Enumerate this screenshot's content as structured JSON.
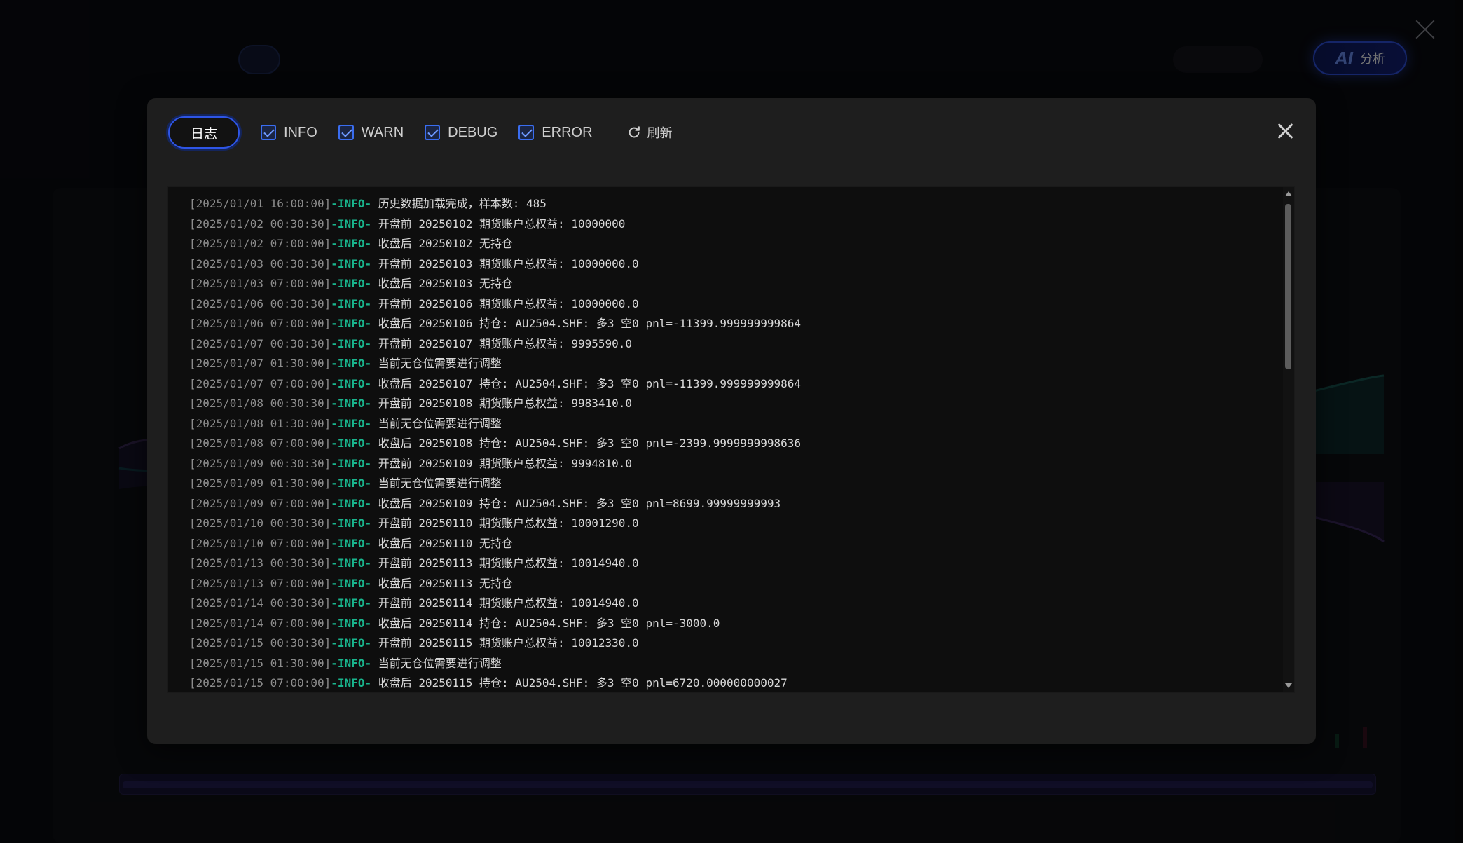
{
  "modal": {
    "tab_label": "日志",
    "filters": [
      {
        "label": "INFO",
        "checked": true
      },
      {
        "label": "WARN",
        "checked": true
      },
      {
        "label": "DEBUG",
        "checked": true
      },
      {
        "label": "ERROR",
        "checked": true
      }
    ],
    "refresh_label": "刷新"
  },
  "header": {
    "ai_glyph": "AI",
    "ai_label": "分析"
  },
  "logs": [
    {
      "ts": "[2025/01/01 16:00:00]",
      "level": "-INFO-",
      "msg": " 历史数据加载完成，样本数: 485"
    },
    {
      "ts": "[2025/01/02 00:30:30]",
      "level": "-INFO-",
      "msg": " 开盘前 20250102 期货账户总权益: 10000000"
    },
    {
      "ts": "[2025/01/02 07:00:00]",
      "level": "-INFO-",
      "msg": " 收盘后 20250102 无持仓"
    },
    {
      "ts": "[2025/01/03 00:30:30]",
      "level": "-INFO-",
      "msg": " 开盘前 20250103 期货账户总权益: 10000000.0"
    },
    {
      "ts": "[2025/01/03 07:00:00]",
      "level": "-INFO-",
      "msg": " 收盘后 20250103 无持仓"
    },
    {
      "ts": "[2025/01/06 00:30:30]",
      "level": "-INFO-",
      "msg": " 开盘前 20250106 期货账户总权益: 10000000.0"
    },
    {
      "ts": "[2025/01/06 07:00:00]",
      "level": "-INFO-",
      "msg": " 收盘后 20250106 持仓: AU2504.SHF: 多3 空0 pnl=-11399.999999999864"
    },
    {
      "ts": "[2025/01/07 00:30:30]",
      "level": "-INFO-",
      "msg": " 开盘前 20250107 期货账户总权益: 9995590.0"
    },
    {
      "ts": "[2025/01/07 01:30:00]",
      "level": "-INFO-",
      "msg": " 当前无仓位需要进行调整"
    },
    {
      "ts": "[2025/01/07 07:00:00]",
      "level": "-INFO-",
      "msg": " 收盘后 20250107 持仓: AU2504.SHF: 多3 空0 pnl=-11399.999999999864"
    },
    {
      "ts": "[2025/01/08 00:30:30]",
      "level": "-INFO-",
      "msg": " 开盘前 20250108 期货账户总权益: 9983410.0"
    },
    {
      "ts": "[2025/01/08 01:30:00]",
      "level": "-INFO-",
      "msg": " 当前无仓位需要进行调整"
    },
    {
      "ts": "[2025/01/08 07:00:00]",
      "level": "-INFO-",
      "msg": " 收盘后 20250108 持仓: AU2504.SHF: 多3 空0 pnl=-2399.9999999998636"
    },
    {
      "ts": "[2025/01/09 00:30:30]",
      "level": "-INFO-",
      "msg": " 开盘前 20250109 期货账户总权益: 9994810.0"
    },
    {
      "ts": "[2025/01/09 01:30:00]",
      "level": "-INFO-",
      "msg": " 当前无仓位需要进行调整"
    },
    {
      "ts": "[2025/01/09 07:00:00]",
      "level": "-INFO-",
      "msg": " 收盘后 20250109 持仓: AU2504.SHF: 多3 空0 pnl=8699.99999999993"
    },
    {
      "ts": "[2025/01/10 00:30:30]",
      "level": "-INFO-",
      "msg": " 开盘前 20250110 期货账户总权益: 10001290.0"
    },
    {
      "ts": "[2025/01/10 07:00:00]",
      "level": "-INFO-",
      "msg": " 收盘后 20250110 无持仓"
    },
    {
      "ts": "[2025/01/13 00:30:30]",
      "level": "-INFO-",
      "msg": " 开盘前 20250113 期货账户总权益: 10014940.0"
    },
    {
      "ts": "[2025/01/13 07:00:00]",
      "level": "-INFO-",
      "msg": " 收盘后 20250113 无持仓"
    },
    {
      "ts": "[2025/01/14 00:30:30]",
      "level": "-INFO-",
      "msg": " 开盘前 20250114 期货账户总权益: 10014940.0"
    },
    {
      "ts": "[2025/01/14 07:00:00]",
      "level": "-INFO-",
      "msg": " 收盘后 20250114 持仓: AU2504.SHF: 多3 空0 pnl=-3000.0"
    },
    {
      "ts": "[2025/01/15 00:30:30]",
      "level": "-INFO-",
      "msg": " 开盘前 20250115 期货账户总权益: 10012330.0"
    },
    {
      "ts": "[2025/01/15 01:30:00]",
      "level": "-INFO-",
      "msg": " 当前无仓位需要进行调整"
    },
    {
      "ts": "[2025/01/15 07:00:00]",
      "level": "-INFO-",
      "msg": " 收盘后 20250115 持仓: AU2504.SHF: 多3 空0 pnl=6720.000000000027"
    }
  ],
  "colors": {
    "accent": "#2e55e6",
    "log_level": "#19b58d",
    "timestamp": "#8d8d8d"
  }
}
